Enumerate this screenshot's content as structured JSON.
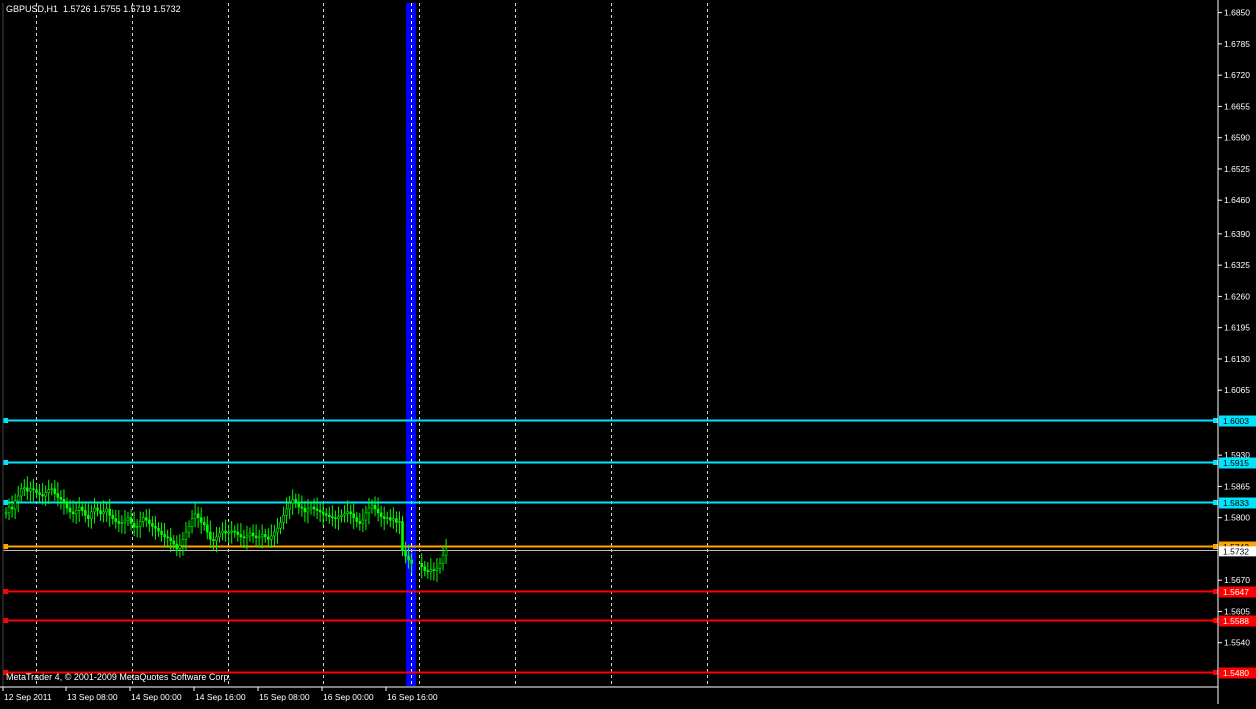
{
  "header": {
    "symbol": "GBPUSD,H1",
    "ohlc": "1.5726 1.5755 1.5719 1.5732"
  },
  "footer": {
    "copyright": "MetaTrader 4, © 2001-2009 MetaQuotes Software Corp."
  },
  "colors": {
    "background": "#000000",
    "candle": "#00ff00",
    "axis": "#ffffff",
    "grid": "#ffffff",
    "support_resistance_cyan": "#00e5ff",
    "current_level_orange": "#ffa500",
    "level_red": "#ff0000",
    "marker_blue": "#0000ff"
  },
  "chart_data": {
    "type": "candlestick",
    "title": "",
    "xlabel": "",
    "ylabel": "",
    "ylim": [
      1.545,
      1.687
    ],
    "y_ticks": [
      "1.6850",
      "1.6785",
      "1.6720",
      "1.6655",
      "1.6590",
      "1.6525",
      "1.6460",
      "1.6390",
      "1.6325",
      "1.6260",
      "1.6195",
      "1.6130",
      "1.6065",
      "1.5930",
      "1.5865",
      "1.5800",
      "1.5670",
      "1.5605",
      "1.5540"
    ],
    "x_ticks": [
      "12 Sep 2011",
      "13 Sep 08:00",
      "14 Sep 00:00",
      "14 Sep 16:00",
      "15 Sep 08:00",
      "16 Sep 00:00",
      "16 Sep 16:00"
    ],
    "vertical_grid_count": 8,
    "horizontal_levels": [
      {
        "value": 1.6003,
        "label": "1.6003",
        "color": "cyan"
      },
      {
        "value": 1.5915,
        "label": "1.5915",
        "color": "cyan"
      },
      {
        "value": 1.5833,
        "label": "1.5833",
        "color": "cyan"
      },
      {
        "value": 1.5742,
        "label": "1.5742",
        "color": "orange"
      },
      {
        "value": 1.5647,
        "label": "1.5647",
        "color": "red"
      },
      {
        "value": 1.5588,
        "label": "1.5588",
        "color": "red"
      },
      {
        "value": 1.548,
        "label": "1.5480",
        "color": "red"
      }
    ],
    "current_price": 1.5732,
    "current_price_label": "1.5732",
    "close_prices": [
      1.581,
      1.5822,
      1.5818,
      1.5835,
      1.5845,
      1.586,
      1.5862,
      1.5855,
      1.586,
      1.5858,
      1.5852,
      1.5848,
      1.5845,
      1.5852,
      1.5858,
      1.586,
      1.585,
      1.5842,
      1.5838,
      1.583,
      1.582,
      1.5812,
      1.5808,
      1.5815,
      1.5822,
      1.5815,
      1.5805,
      1.5798,
      1.5812,
      1.582,
      1.5815,
      1.5808,
      1.5812,
      1.5818,
      1.5805,
      1.5798,
      1.5792,
      1.5788,
      1.579,
      1.5795,
      1.58,
      1.5788,
      1.578,
      1.5782,
      1.5792,
      1.58,
      1.5795,
      1.5788,
      1.5782,
      1.5778,
      1.5772,
      1.5765,
      1.576,
      1.5758,
      1.5752,
      1.5745,
      1.5735,
      1.5742,
      1.5755,
      1.577,
      1.5782,
      1.5798,
      1.5808,
      1.58,
      1.579,
      1.5785,
      1.577,
      1.5755,
      1.5752,
      1.576,
      1.5768,
      1.5772,
      1.5768,
      1.577,
      1.5772,
      1.577,
      1.5765,
      1.576,
      1.5758,
      1.5762,
      1.5768,
      1.5762,
      1.5758,
      1.576,
      1.5765,
      1.576,
      1.5755,
      1.5762,
      1.577,
      1.5778,
      1.579,
      1.5805,
      1.5818,
      1.583,
      1.5838,
      1.5832,
      1.5822,
      1.582,
      1.5812,
      1.5818,
      1.5822,
      1.5818,
      1.5815,
      1.5812,
      1.5808,
      1.5805,
      1.5802,
      1.58,
      1.5798,
      1.5802,
      1.5805,
      1.5808,
      1.5812,
      1.5808,
      1.58,
      1.5792,
      1.5788,
      1.5795,
      1.581,
      1.582,
      1.5826,
      1.5818,
      1.581,
      1.5802,
      1.5798,
      1.58,
      1.5795,
      1.5798,
      1.579,
      1.5792,
      1.5732,
      1.572,
      1.5712,
      1.5705,
      1.5698,
      1.569,
      1.5688,
      1.5692,
      1.569,
      1.5695,
      1.5705,
      1.5722,
      1.5732
    ]
  }
}
